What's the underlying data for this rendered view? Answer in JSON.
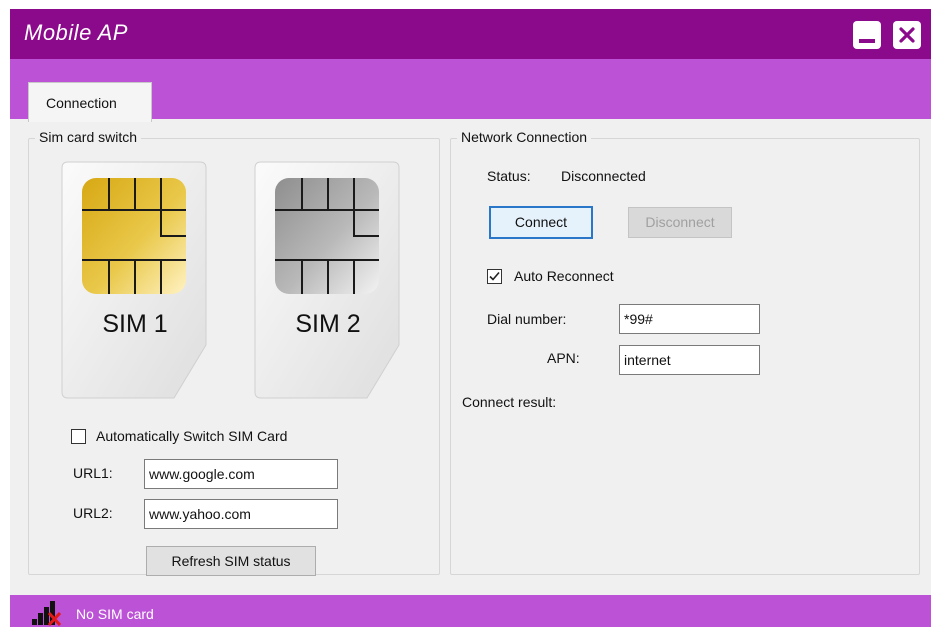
{
  "window": {
    "title": "Mobile AP"
  },
  "tabs": [
    {
      "label": "Connection"
    }
  ],
  "sim_switch": {
    "group_title": "Sim card switch",
    "sim1_label": "SIM 1",
    "sim2_label": "SIM 2",
    "auto_switch_label": "Automatically Switch SIM Card",
    "auto_switch_checked": false,
    "url1_label": "URL1:",
    "url1_value": "www.google.com",
    "url2_label": "URL2:",
    "url2_value": "www.yahoo.com",
    "refresh_label": "Refresh SIM status"
  },
  "network": {
    "group_title": "Network Connection",
    "status_label": "Status:",
    "status_value": "Disconnected",
    "connect_label": "Connect",
    "disconnect_label": "Disconnect",
    "auto_reconnect_label": "Auto Reconnect",
    "auto_reconnect_checked": true,
    "dial_label": "Dial number:",
    "dial_value": "*99#",
    "apn_label": "APN:",
    "apn_value": "internet",
    "result_label": "Connect result:"
  },
  "statusbar": {
    "text": "No SIM card",
    "icon": "no-signal-icon"
  },
  "colors": {
    "titlebar": "#8b0a8b",
    "accent": "#bc52d6",
    "sim1_chip": "gold",
    "sim2_chip": "silver"
  }
}
